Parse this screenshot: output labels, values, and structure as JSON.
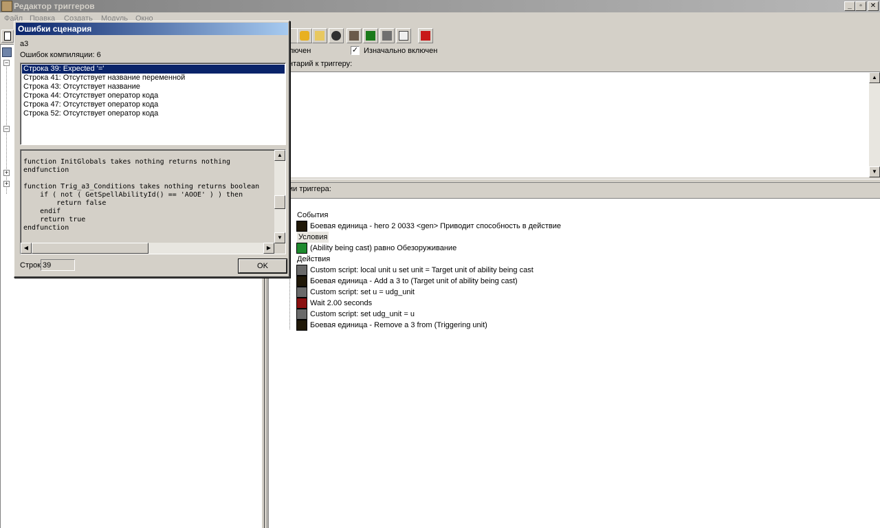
{
  "window": {
    "title": "Редактор триггеров",
    "controls": {
      "minimize": "_",
      "maximize": "▫",
      "close": "✕"
    }
  },
  "menu": [
    "Файл",
    "Правка",
    "Создать",
    "Модуль",
    "Окно"
  ],
  "trigger": {
    "enabled_label_partial": "лючен",
    "initially_enabled_label": "Изначально включен",
    "initially_enabled_checked": true,
    "comment_label_partial": "нтарий к триггеру:",
    "functions_label_partial": "ии триггера:",
    "events_heading": "События",
    "conditions_heading": "Условия",
    "actions_heading": "Действия",
    "events": [
      {
        "icon": "unit-icon",
        "text": "Боевая единица - hero 2 0033 <gen> Приводит способность в действие"
      }
    ],
    "conditions": [
      {
        "icon": "ability-icon",
        "text": "(Ability being cast) равно Обезоруживание"
      }
    ],
    "actions": [
      {
        "icon": "custom-script-icon",
        "text": "Custom script:   local unit u set unit = Target unit of ability being cast"
      },
      {
        "icon": "unit-icon",
        "text": "Боевая единица - Add a 3  to (Target unit of ability being cast)"
      },
      {
        "icon": "custom-script-icon",
        "text": "Custom script:   set u = udg_unit"
      },
      {
        "icon": "wait-icon",
        "text": "Wait 2.00 seconds"
      },
      {
        "icon": "custom-script-icon",
        "text": "Custom script:   set udg_unit = u"
      },
      {
        "icon": "unit-icon",
        "text": "Боевая единица - Remove a 3  from (Triggering unit)"
      }
    ]
  },
  "dialog": {
    "title": "Ошибки сценария",
    "trigger_name": "a3",
    "error_count_text": "Ошибок компиляции: 6",
    "errors": [
      {
        "text": "Строка  39: Expected '='",
        "selected": true
      },
      {
        "text": "Строка  41: Отсутствует название переменной",
        "selected": false
      },
      {
        "text": "Строка  43: Отсутствует название",
        "selected": false
      },
      {
        "text": "Строка  44: Отсутствует оператор кода",
        "selected": false
      },
      {
        "text": "Строка  47: Отсутствует оператор кода",
        "selected": false
      },
      {
        "text": "Строка  52: Отсутствует оператор кода",
        "selected": false
      }
    ],
    "code": "function InitGlobals takes nothing returns nothing\nendfunction\n\nfunction Trig_a3_Conditions takes nothing returns boolean\n    if ( not ( GetSpellAbilityId() == 'AOOE' ) ) then\n        return false\n    endif\n    return true\nendfunction",
    "line_label": "Строк",
    "line_value": "39",
    "ok_label": "OK"
  },
  "colors": {
    "face": "#d4d0c8",
    "selection": "#0a246a",
    "active_title_start": "#0a246a",
    "active_title_end": "#a6caf0"
  }
}
